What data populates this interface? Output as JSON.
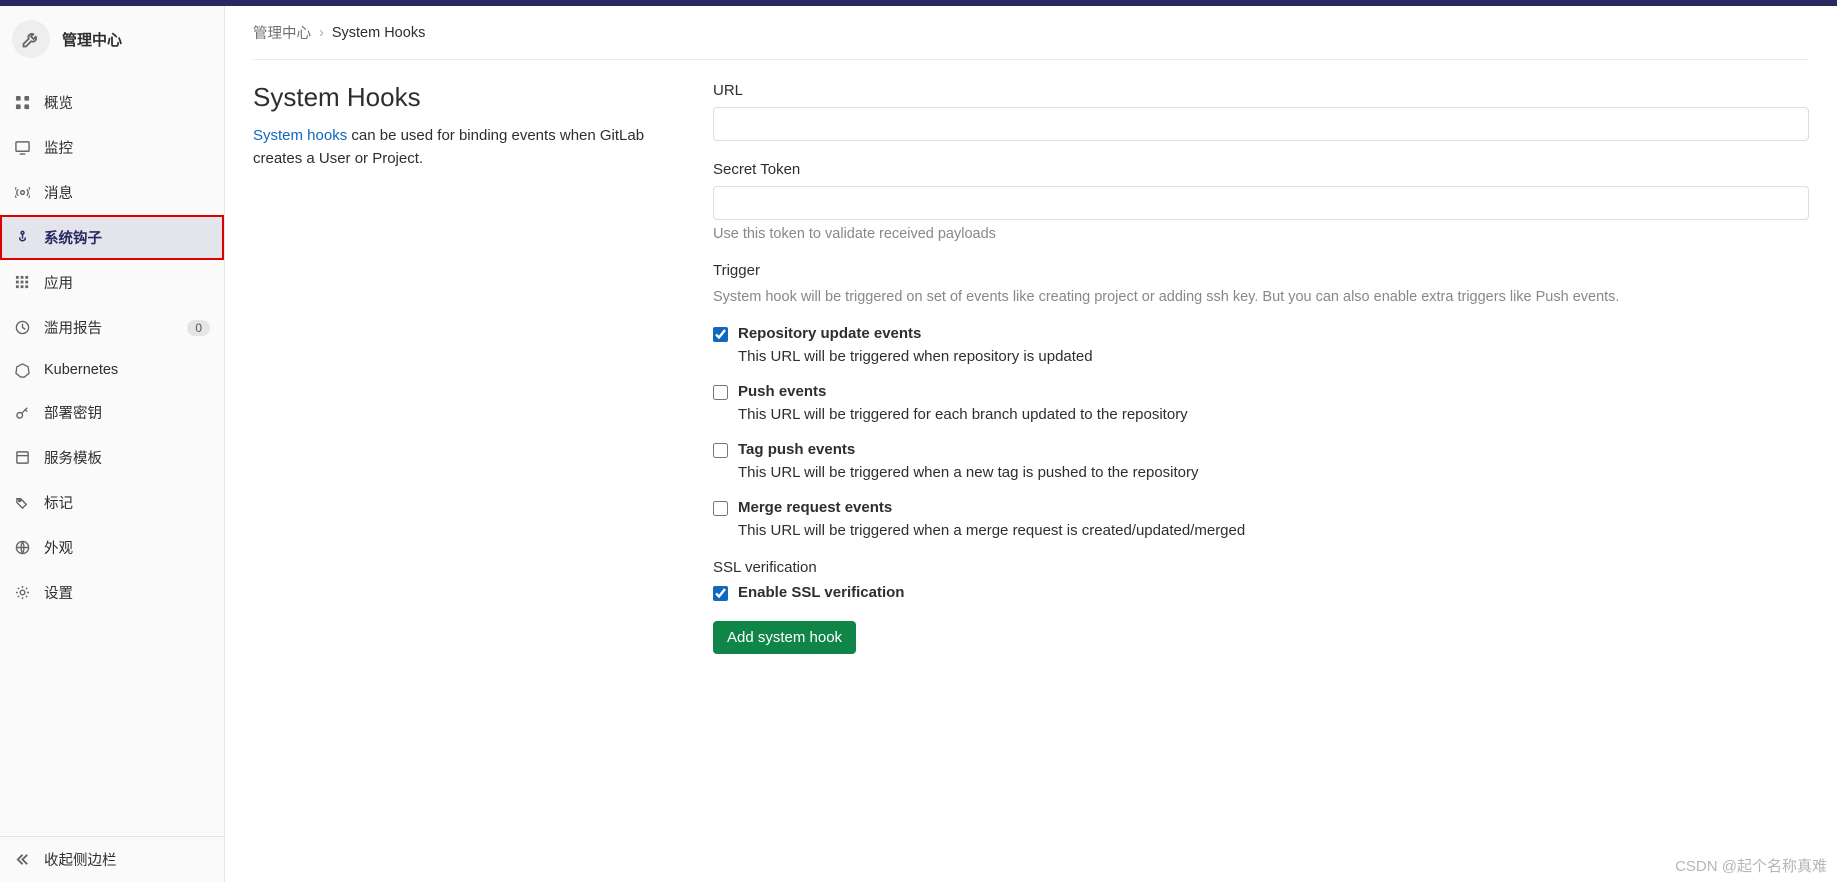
{
  "sidebar": {
    "title": "管理中心",
    "items": [
      {
        "label": "概览",
        "icon": "overview"
      },
      {
        "label": "监控",
        "icon": "monitor"
      },
      {
        "label": "消息",
        "icon": "broadcast"
      },
      {
        "label": "系统钩子",
        "icon": "hook",
        "active": true,
        "highlighted": true
      },
      {
        "label": "应用",
        "icon": "apps"
      },
      {
        "label": "滥用报告",
        "icon": "clock",
        "badge": "0"
      },
      {
        "label": "Kubernetes",
        "icon": "kubernetes"
      },
      {
        "label": "部署密钥",
        "icon": "key"
      },
      {
        "label": "服务模板",
        "icon": "template"
      },
      {
        "label": "标记",
        "icon": "tag"
      },
      {
        "label": "外观",
        "icon": "appearance"
      },
      {
        "label": "设置",
        "icon": "settings"
      }
    ],
    "footer_label": "收起侧边栏"
  },
  "breadcrumb": {
    "root": "管理中心",
    "separator": "›",
    "current": "System Hooks"
  },
  "page": {
    "title": "System Hooks",
    "desc_link": "System hooks",
    "desc_rest": " can be used for binding events when GitLab creates a User or Project."
  },
  "form": {
    "url_label": "URL",
    "secret_label": "Secret Token",
    "secret_help": "Use this token to validate received payloads",
    "trigger_label": "Trigger",
    "trigger_desc": "System hook will be triggered on set of events like creating project or adding ssh key. But you can also enable extra triggers like Push events.",
    "triggers": [
      {
        "label": "Repository update events",
        "help": "This URL will be triggered when repository is updated",
        "checked": true
      },
      {
        "label": "Push events",
        "help": "This URL will be triggered for each branch updated to the repository",
        "checked": false
      },
      {
        "label": "Tag push events",
        "help": "This URL will be triggered when a new tag is pushed to the repository",
        "checked": false
      },
      {
        "label": "Merge request events",
        "help": "This URL will be triggered when a merge request is created/updated/merged",
        "checked": false
      }
    ],
    "ssl_label": "SSL verification",
    "ssl_checkbox_label": "Enable SSL verification",
    "ssl_checked": true,
    "submit_label": "Add system hook"
  },
  "watermark": "CSDN @起个名称真难"
}
